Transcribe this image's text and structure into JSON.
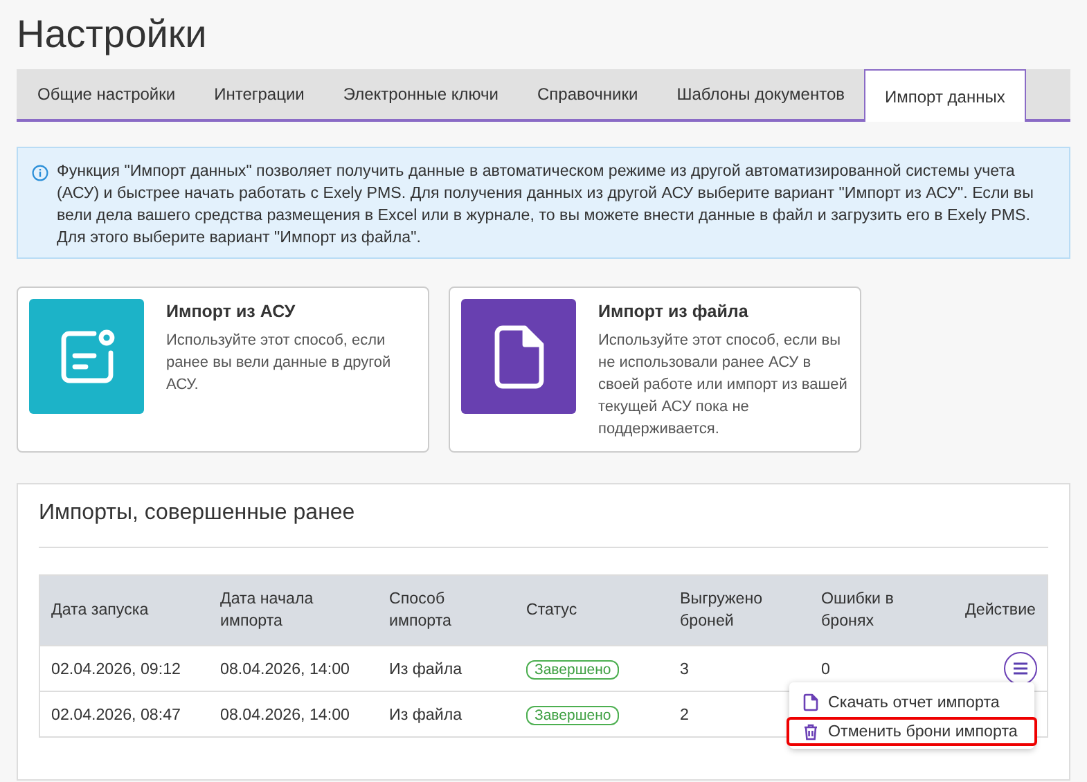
{
  "page_title": "Настройки",
  "tabs": [
    {
      "label": "Общие настройки",
      "selected": false
    },
    {
      "label": "Интеграции",
      "selected": false
    },
    {
      "label": "Электронные ключи",
      "selected": false
    },
    {
      "label": "Справочники",
      "selected": false
    },
    {
      "label": "Шаблоны документов",
      "selected": false
    },
    {
      "label": "Импорт данных",
      "selected": true
    }
  ],
  "info": "Функция \"Импорт данных\" позволяет получить данные в автоматическом режиме из другой автоматизированной системы учета (АСУ) и быстрее начать работать с Exely PMS. Для получения данных из другой АСУ выберите вариант \"Импорт из АСУ\". Если вы вели дела вашего средства размещения в Excel или в журнале, то вы можете внести данные в файл и загрузить его в Exely PMS. Для этого выберите вариант \"Импорт из файла\".",
  "options": [
    {
      "kind": "asu",
      "title": "Импорт из АСУ",
      "text": "Используйте этот способ, если ранее вы вели данные в другой АСУ."
    },
    {
      "kind": "file",
      "title": "Импорт из файла",
      "text": "Используйте этот способ, если вы не использовали ранее АСУ в своей работе или импорт из вашей текущей АСУ пока не поддерживается."
    }
  ],
  "imports": {
    "title": "Импорты, совершенные ранее",
    "columns": [
      "Дата запуска",
      "Дата начала импорта",
      "Способ импорта",
      "Статус",
      "Выгружено броней",
      "Ошибки в бронях",
      "Действие"
    ],
    "rows": [
      {
        "started": "02.04.2026, 09:12",
        "from": "08.04.2026, 14:00",
        "method": "Из файла",
        "status": "Завершено",
        "loaded": "3",
        "errors": "0",
        "menu_open": true
      },
      {
        "started": "02.04.2026, 08:47",
        "from": "08.04.2026, 14:00",
        "method": "Из файла",
        "status": "Завершено",
        "loaded": "2"
      }
    ],
    "menu": [
      {
        "kind": "download",
        "label": "Скачать отчет импорта",
        "highlighted": false
      },
      {
        "kind": "delete",
        "label": "Отменить брони импорта",
        "highlighted": true
      }
    ]
  }
}
